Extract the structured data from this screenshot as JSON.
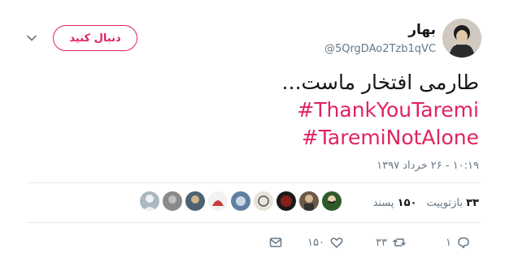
{
  "user": {
    "display_name": "بهار",
    "handle": "@5QrgDAo2Tzb1qVC",
    "follow_label": "دنبال کنید"
  },
  "tweet": {
    "text": "طارمی افتخار ماست...",
    "hashtags": [
      "#ThankYouTaremi",
      "#TaremiNotAlone"
    ],
    "timestamp": "۱۰:۱۹ - ۲۶ خرداد ۱۳۹۷"
  },
  "stats": {
    "retweet_count": "۳۳",
    "retweet_label": "بازتوییت",
    "like_count": "۱۵۰",
    "like_label": "پسند"
  },
  "actions": {
    "reply_count": "۱",
    "retweet_count": "۳۳",
    "like_count": "۱۵۰"
  },
  "colors": {
    "accent": "#e0245e",
    "muted": "#657786",
    "divider": "#e6ecf0"
  },
  "icons": [
    "chevron-down-icon",
    "reply-icon",
    "retweet-icon",
    "heart-icon",
    "message-icon"
  ]
}
